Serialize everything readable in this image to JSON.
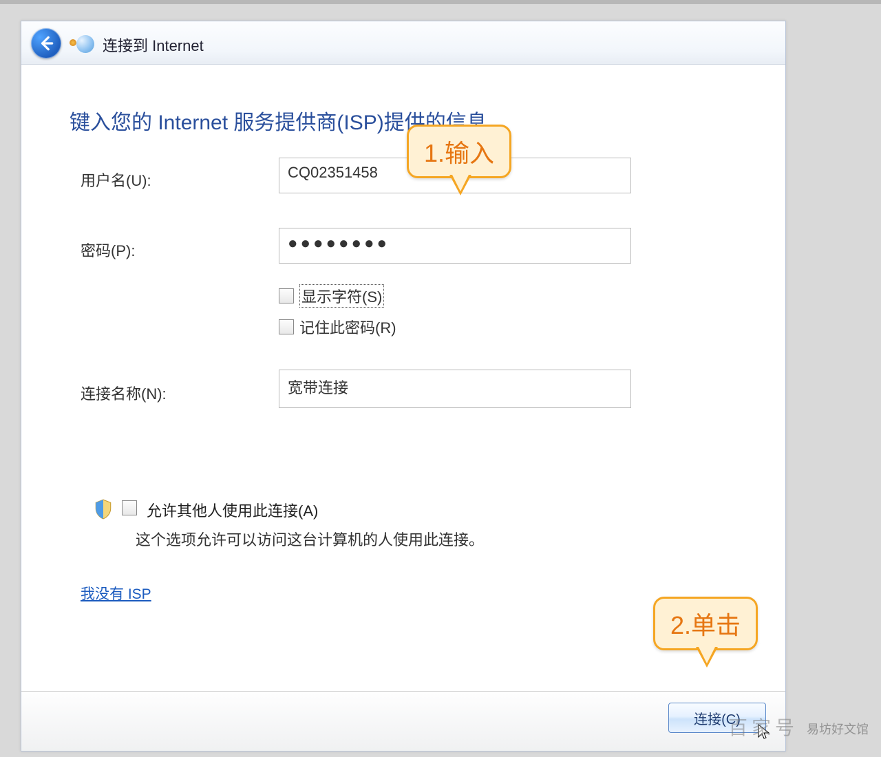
{
  "window": {
    "title": "连接到 Internet",
    "heading": "键入您的 Internet 服务提供商(ISP)提供的信息"
  },
  "form": {
    "username_label": "用户名(U):",
    "username_value": "CQ02351458",
    "password_label": "密码(P):",
    "password_masked": "●●●●●●●●",
    "show_chars_label": "显示字符(S)",
    "remember_pw_label": "记住此密码(R)",
    "connection_name_label": "连接名称(N):",
    "connection_name_value": "宽带连接"
  },
  "allow": {
    "label": "允许其他人使用此连接(A)",
    "desc": "这个选项允许可以访问这台计算机的人使用此连接。"
  },
  "no_isp_link": "我没有 ISP",
  "connect_button": "连接(C)",
  "annotations": {
    "step1": "1.输入",
    "step2": "2.单击"
  },
  "watermark": {
    "left": "百家号",
    "right": "易坊好文馆"
  }
}
